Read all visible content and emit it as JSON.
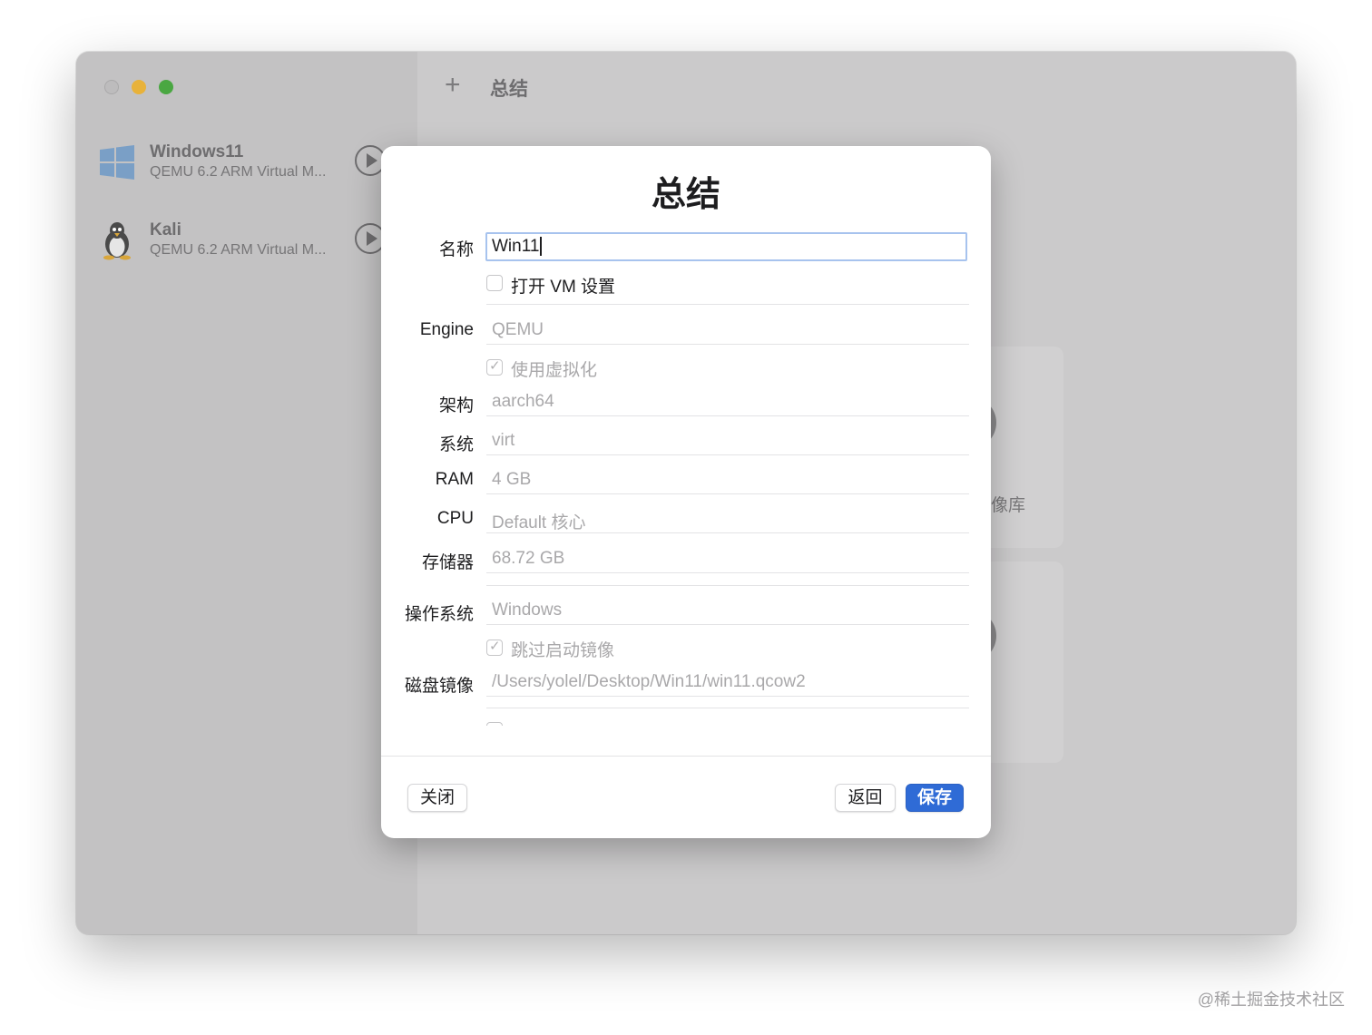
{
  "window": {
    "toolbar_plus": "+",
    "toolbar_title": "总结"
  },
  "sidebar": {
    "items": [
      {
        "name": "Windows11",
        "subtitle": "QEMU 6.2 ARM Virtual M...",
        "icon": "windows-logo-icon"
      },
      {
        "name": "Kali",
        "subtitle": "QEMU 6.2 ARM Virtual M...",
        "icon": "linux-penguin-icon"
      }
    ]
  },
  "background": {
    "partial_text": "像库"
  },
  "dialog": {
    "title": "总结",
    "name_label": "名称",
    "name_value": "Win11",
    "open_vm_settings_label": "打开 VM 设置",
    "open_vm_settings_checked": false,
    "engine_label": "Engine",
    "engine_value": "QEMU",
    "virtualization_label": "使用虚拟化",
    "virtualization_checked": true,
    "arch_label": "架构",
    "arch_value": "aarch64",
    "system_label": "系统",
    "system_value": "virt",
    "ram_label": "RAM",
    "ram_value": "4 GB",
    "cpu_label": "CPU",
    "cpu_value": "Default 核心",
    "storage_label": "存储器",
    "storage_value": "68.72 GB",
    "os_label": "操作系统",
    "os_value": "Windows",
    "skip_boot_label": "跳过启动镜像",
    "skip_boot_checked": true,
    "disk_image_label": "磁盘镜像",
    "disk_image_value": "/Users/yolel/Desktop/Win11/win11.qcow2",
    "close_button": "关闭",
    "back_button": "返回",
    "save_button": "保存"
  },
  "watermark": "@稀土掘金技术社区",
  "colors": {
    "accent": "#2f6bd6",
    "input_focus": "#a7c3ee",
    "traffic_min": "#e8b23a",
    "traffic_max": "#4aa742"
  }
}
